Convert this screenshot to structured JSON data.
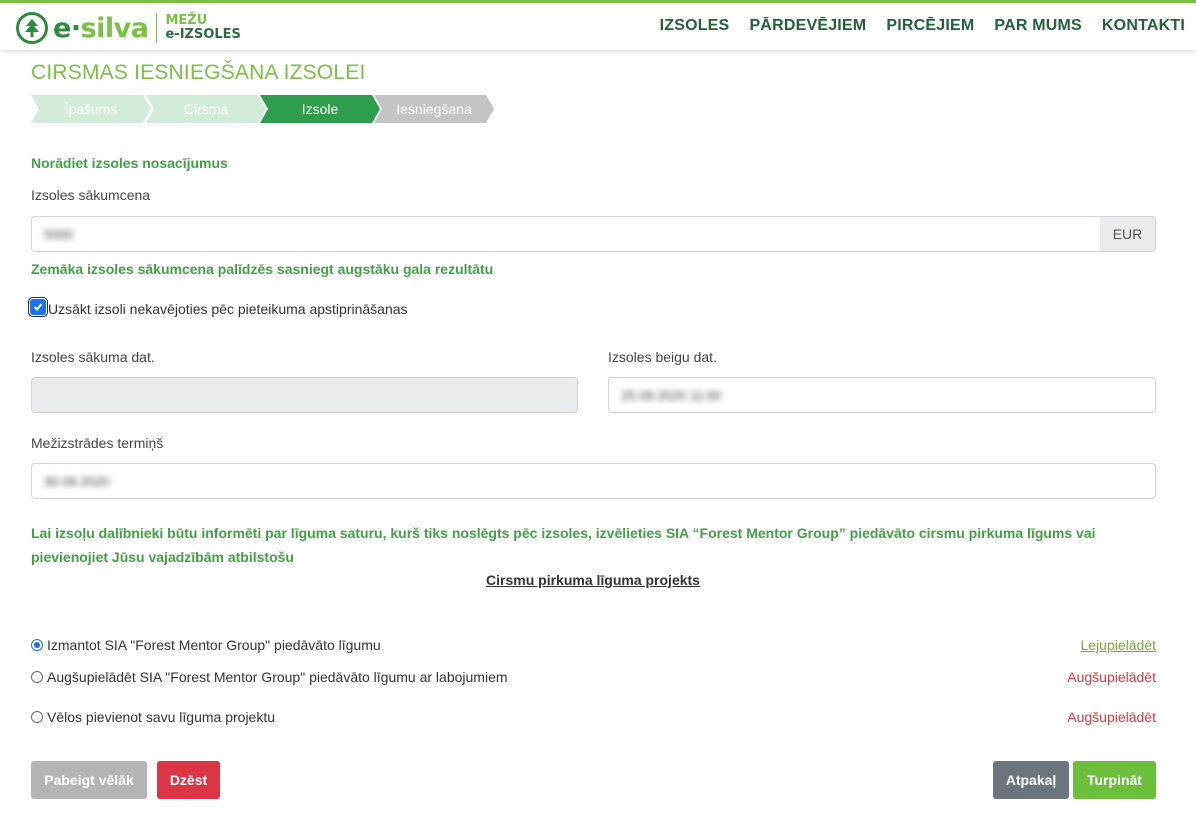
{
  "header": {
    "logo": {
      "e": "e",
      "dot": "·",
      "silva": "silva",
      "line1": "MEŽU",
      "line2": "e-IZSOLES"
    },
    "nav": [
      "IZSOLES",
      "PĀRDEVĒJIEM",
      "PIRCĒJIEM",
      "PAR MUMS",
      "KONTAKTI"
    ]
  },
  "page_title": "CIRSMAS IESNIEGŠANA IZSOLEI",
  "steps": [
    {
      "label": "Īpašums",
      "state": "done"
    },
    {
      "label": "Cirsma",
      "state": "done"
    },
    {
      "label": "Izsole",
      "state": "active"
    },
    {
      "label": "Iesniegšana",
      "state": "todo"
    }
  ],
  "form": {
    "section_title": "Norādiet izsoles nosacījumus",
    "start_price_label": "Izsoles sākumcena",
    "start_price_value": "5000",
    "currency": "EUR",
    "price_hint": "Zemāka izsoles sākumcena palīdzēs sasniegt augstāku gala rezultātu",
    "start_immediately_label": "Uzsākt izsoli nekavējoties pēc pieteikuma apstiprināšanas",
    "start_date_label": "Izsoles sākuma dat.",
    "end_date_label": "Izsoles beigu dat.",
    "end_date_value": "25.09.2020 11:00",
    "logging_deadline_label": "Mežizstrādes termiņš",
    "logging_deadline_value": "30.09.2020"
  },
  "contract": {
    "info": "Lai izsoļu dalībnieki būtu informēti par līguma saturu, kurš tiks noslēgts pēc izsoles, izvēlieties SIA “Forest Mentor Group” piedāvāto cirsmu pirkuma līgums vai pievienojiet Jūsu vajadzībām atbilstošu",
    "draft_link": "Cirsmu pirkuma līguma projekts",
    "options": [
      {
        "label": "Izmantot SIA \"Forest Mentor Group\" piedāvāto līgumu",
        "action": "Lejupielādēt",
        "checked": true
      },
      {
        "label": "Augšupielādēt SIA \"Forest Mentor Group\" piedāvāto līgumu ar labojumiem",
        "action": "Augšupielādēt",
        "checked": false
      },
      {
        "label": "Vēlos pievienot savu līguma projektu",
        "action": "Augšupielādēt",
        "checked": false
      }
    ]
  },
  "buttons": {
    "finish_later": "Pabeigt vēlāk",
    "delete": "Dzēst",
    "back": "Atpakaļ",
    "continue": "Turpināt"
  },
  "colors": {
    "brand_green": "#7ac143",
    "dark_green": "#24603a",
    "active_step": "#2e9e4d",
    "danger": "#dc3545"
  }
}
